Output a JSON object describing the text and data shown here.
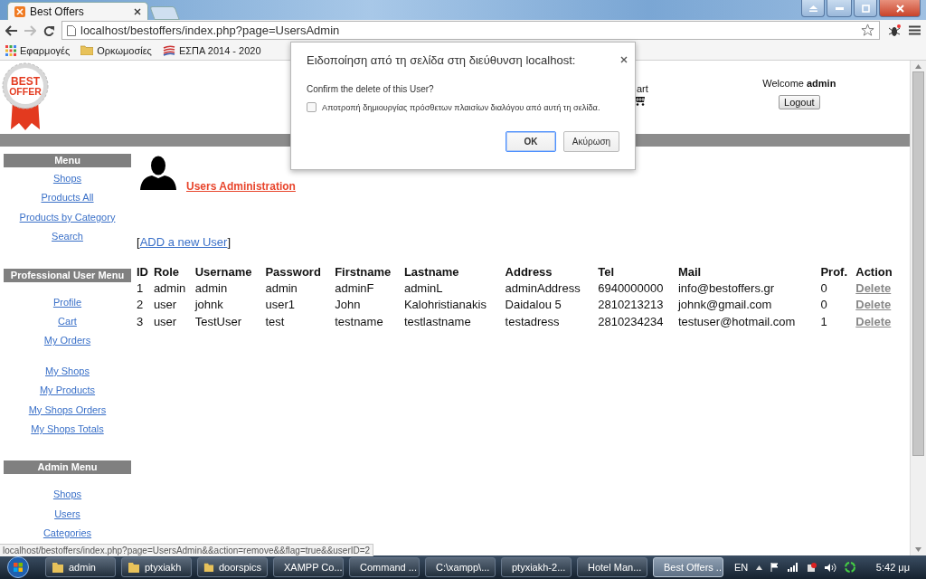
{
  "browser": {
    "tab": {
      "title": "Best Offers",
      "selected": true
    },
    "address": "localhost/bestoffers/index.php?page=UsersAdmin",
    "bookmarks": [
      {
        "label": "Εφαρμογές",
        "kind": "apps"
      },
      {
        "label": "Ορκωμοσίες",
        "kind": "folder"
      },
      {
        "label": "ΕΣΠΑ 2014 - 2020",
        "kind": "site"
      }
    ]
  },
  "header": {
    "logo": [
      "BEST",
      "OFFER"
    ],
    "cart_label": "art",
    "welcome": "Welcome **admin**",
    "logout": "Logout"
  },
  "sidebar": [
    {
      "title": "Menu",
      "groups": [
        [
          "Shops",
          "Products All",
          "Products by Category",
          "Search"
        ]
      ]
    },
    {
      "title": "Professional User Menu",
      "groups": [
        [
          "Profile",
          "Cart",
          "My Orders"
        ],
        [
          "My Shops",
          "My Products",
          "My Shops Orders",
          "My Shops Totals"
        ]
      ]
    },
    {
      "title": "Admin Menu",
      "groups": [
        [
          "Shops",
          "Users",
          "Categories"
        ]
      ]
    }
  ],
  "page": {
    "title": "Users Administration",
    "add_link": {
      "open": "[",
      "label": "ADD a new User",
      "close": "]"
    }
  },
  "table": {
    "columns": [
      "ID",
      "Role",
      "Username",
      "Password",
      "Firstname",
      "Lastname",
      "Address",
      "Tel",
      "Mail",
      "Prof.",
      "Action"
    ],
    "rows": [
      [
        "1",
        "admin",
        "admin",
        "admin",
        "adminF",
        "adminL",
        "adminAddress",
        "6940000000",
        "info@bestoffers.gr",
        "0",
        "Delete"
      ],
      [
        "2",
        "user",
        "johnk",
        "user1",
        "John",
        "Kalohristianakis",
        "Daidalou 5",
        "2810213213",
        "johnk@gmail.com",
        "0",
        "Delete"
      ],
      [
        "3",
        "user",
        "TestUser",
        "test",
        "testname",
        "testlastname",
        "testadress",
        "2810234234",
        "testuser@hotmail.com",
        "1",
        "Delete"
      ]
    ]
  },
  "dialog": {
    "title": "Ειδοποίηση από τη σελίδα στη διεύθυνση localhost:",
    "message": "Confirm the delete of this User?",
    "checkbox": {
      "label": "Αποτροπή δημιουργίας πρόσθετων πλαισίων διαλόγου από αυτή τη σελίδα.",
      "checked": false
    },
    "buttons": [
      {
        "label": "OK",
        "selected": true
      },
      {
        "label": "Ακύρωση",
        "selected": false
      }
    ]
  },
  "status_url": "localhost/bestoffers/index.php?page=UsersAdmin&&action=remove&&flag=true&&userID=2",
  "taskbar": {
    "items": [
      {
        "label": "admin",
        "kind": "folder",
        "selected": false
      },
      {
        "label": "ptyxiakh",
        "kind": "folder",
        "selected": false
      },
      {
        "label": "doorspics",
        "kind": "folder",
        "selected": false
      },
      {
        "label": "XAMPP Co...",
        "kind": "xampp",
        "selected": false
      },
      {
        "label": "Command ...",
        "kind": "console",
        "selected": false
      },
      {
        "label": "C:\\xampp\\...",
        "kind": "notepad",
        "selected": false
      },
      {
        "label": "ptyxiakh-2...",
        "kind": "document",
        "selected": false
      },
      {
        "label": "Hotel Man...",
        "kind": "browser",
        "selected": false
      },
      {
        "label": "Best Offers ...",
        "kind": "browser",
        "selected": true
      }
    ],
    "language": "EN",
    "clock": "5:42 μμ"
  }
}
